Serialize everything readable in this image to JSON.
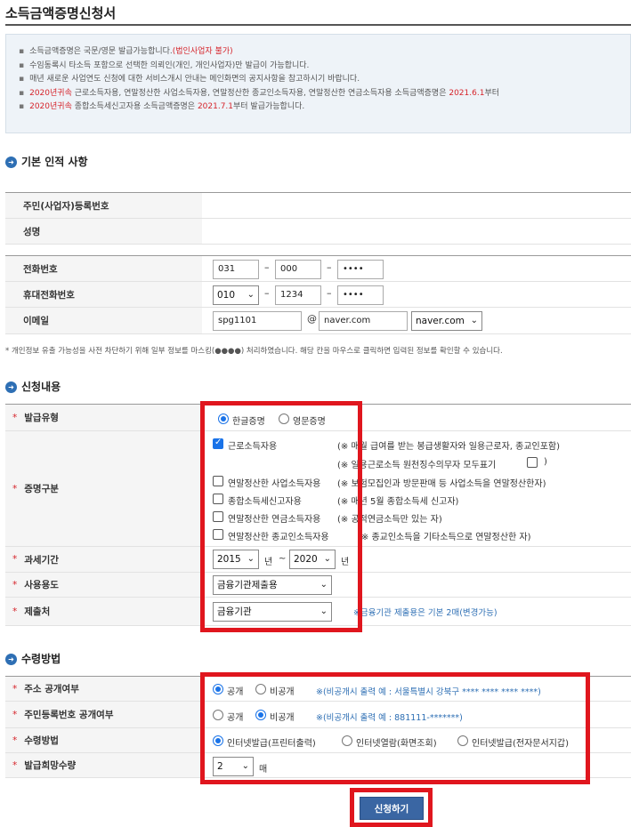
{
  "page": {
    "title": "소득금액증명신청서"
  },
  "notice": {
    "bullet": "▪",
    "items": [
      {
        "pre": "소득금액증명은 국문/영문 발급가능합니다.",
        "red": "(법인사업자 불가)",
        "post": ""
      },
      {
        "pre": "수임동록시 타소득 포함으로 선택한 의뢰인(개인, 개인사업자)만 발급이 가능합니다.",
        "red": "",
        "post": ""
      },
      {
        "pre": "매년 새로운 사업연도 신청에 대한 서비스개시 안내는 메인화면의 공지사항을 참고하시기 바랍니다.",
        "red": "",
        "post": ""
      },
      {
        "pre": "",
        "red": "2020년귀속",
        "post": " 근로소득자용, 연말정산한 사업소득자용, 연말정산한 종교인소득자용, 연말정산한 연금소득자용 소득금액증명은 ",
        "red2": "2021.6.1",
        "post2": "부터"
      },
      {
        "pre": "",
        "red": "2020년귀속",
        "post": " 종합소득세신고자용 소득금액증명은 ",
        "red2": "2021.7.1",
        "post2": "부터 발급가능합니다."
      }
    ]
  },
  "basic": {
    "section_title": "기본 인적 사항",
    "icon": "circle-arrow-right-icon",
    "rrn_label": "주민(사업자)등록번호",
    "name_label": "성명",
    "phone_label": "전화번호",
    "phone": [
      "031",
      "000",
      "••••"
    ],
    "mobile_label": "휴대전화번호",
    "mobile": [
      "010",
      "1234",
      "••••"
    ],
    "email_label": "이메일",
    "email_id": "spg1101",
    "at": "@",
    "email_domain": "naver.com",
    "email_domain_select": "naver.com",
    "dash": "–",
    "masking_note": "* 개인정보 유출 가능성을 사전 차단하기 위해 일부 정보를 마스킹(●●●●) 처리하였습니다. 해당 칸을 마우스로 클릭하면 입력된 정보를 확인할 수 있습니다."
  },
  "apply": {
    "section_title": "신청내용",
    "req": "*",
    "type_label": "발급유형",
    "type_options": [
      "한글증명",
      "영문증명"
    ],
    "cert_label": "증명구분",
    "cert_items": [
      {
        "label": "근로소득자용",
        "note": "(※ 매월 급여를 받는 봉급생활자와 일용근로자, 종교인포함)"
      },
      {
        "label": "",
        "note": "(※ 일용근로소득 원천징수의무자 모두표기",
        "note_end": ")"
      },
      {
        "label": "연말정산한 사업소득자용",
        "note": "(※ 보험모집인과 방문판매 등 사업소득을 연말정산한자)"
      },
      {
        "label": "종합소득세신고자용",
        "note": "(※ 매년 5월 종합소득세 신고자)"
      },
      {
        "label": "연말정산한 연금소득자용",
        "note": "(※ 공적연금소득만 있는 자)"
      },
      {
        "label": "연말정산한 종교인소득자용",
        "note": "(※ 종교인소득을 기타소득으로 연말정산한 자)"
      }
    ],
    "period_label": "과세기간",
    "period_from": "2015",
    "period_to": "2020",
    "year_unit": "년",
    "tilde": "~",
    "purpose_label": "사용용도",
    "purpose": "금융기관제출용",
    "submit_to_label": "제출처",
    "submit_to": "금융기관",
    "submit_to_hint": "※금융기관 제출용은 기본 2매(변경가능)"
  },
  "receive": {
    "section_title": "수령방법",
    "addr_label": "주소 공개여부",
    "addr_options": [
      "공개",
      "비공개"
    ],
    "addr_hint": "※(비공개시 출력 예 : 서울특별시 강북구 **** **** **** ****)",
    "rrn_label": "주민등록번호 공개여부",
    "rrn_options": [
      "공개",
      "비공개"
    ],
    "rrn_hint": "※(비공개시 출력 예 : 881111-*******)",
    "method_label": "수령방법",
    "method_options": [
      "인터넷발급(프린터출력)",
      "인터넷열람(화면조회)",
      "인터넷발급(전자문서지갑)"
    ],
    "qty_label": "발급희망수량",
    "qty": "2",
    "qty_unit": "매"
  },
  "submit_label": "신청하기",
  "colors": {
    "accent": "#2e6fb4",
    "highlight": "#e0161e",
    "button": "#3a66a3"
  }
}
